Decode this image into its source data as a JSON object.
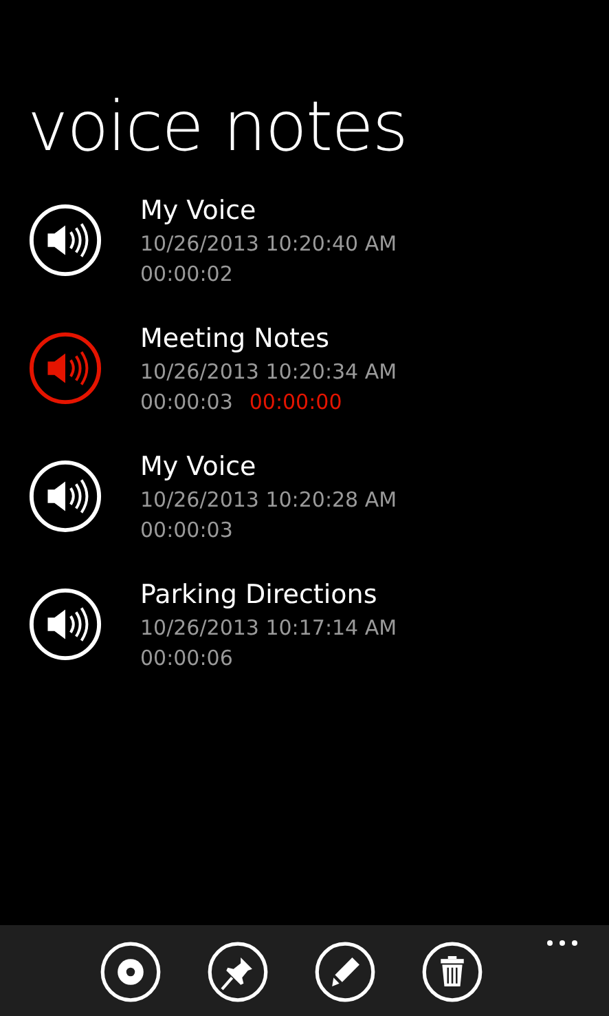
{
  "page_title": "voice notes",
  "notes": [
    {
      "title": "My Voice",
      "date": "10/26/2013 10:20:40 AM",
      "duration": "00:00:02",
      "playing": false
    },
    {
      "title": "Meeting Notes",
      "date": "10/26/2013 10:20:34 AM",
      "duration": "00:00:03",
      "playing": true,
      "elapsed": "00:00:00"
    },
    {
      "title": "My Voice",
      "date": "10/26/2013 10:20:28 AM",
      "duration": "00:00:03",
      "playing": false
    },
    {
      "title": "Parking Directions",
      "date": "10/26/2013 10:17:14 AM",
      "duration": "00:00:06",
      "playing": false
    }
  ],
  "app_bar": {
    "buttons": [
      {
        "kind": "record"
      },
      {
        "kind": "pin"
      },
      {
        "kind": "edit"
      },
      {
        "kind": "delete"
      }
    ]
  }
}
